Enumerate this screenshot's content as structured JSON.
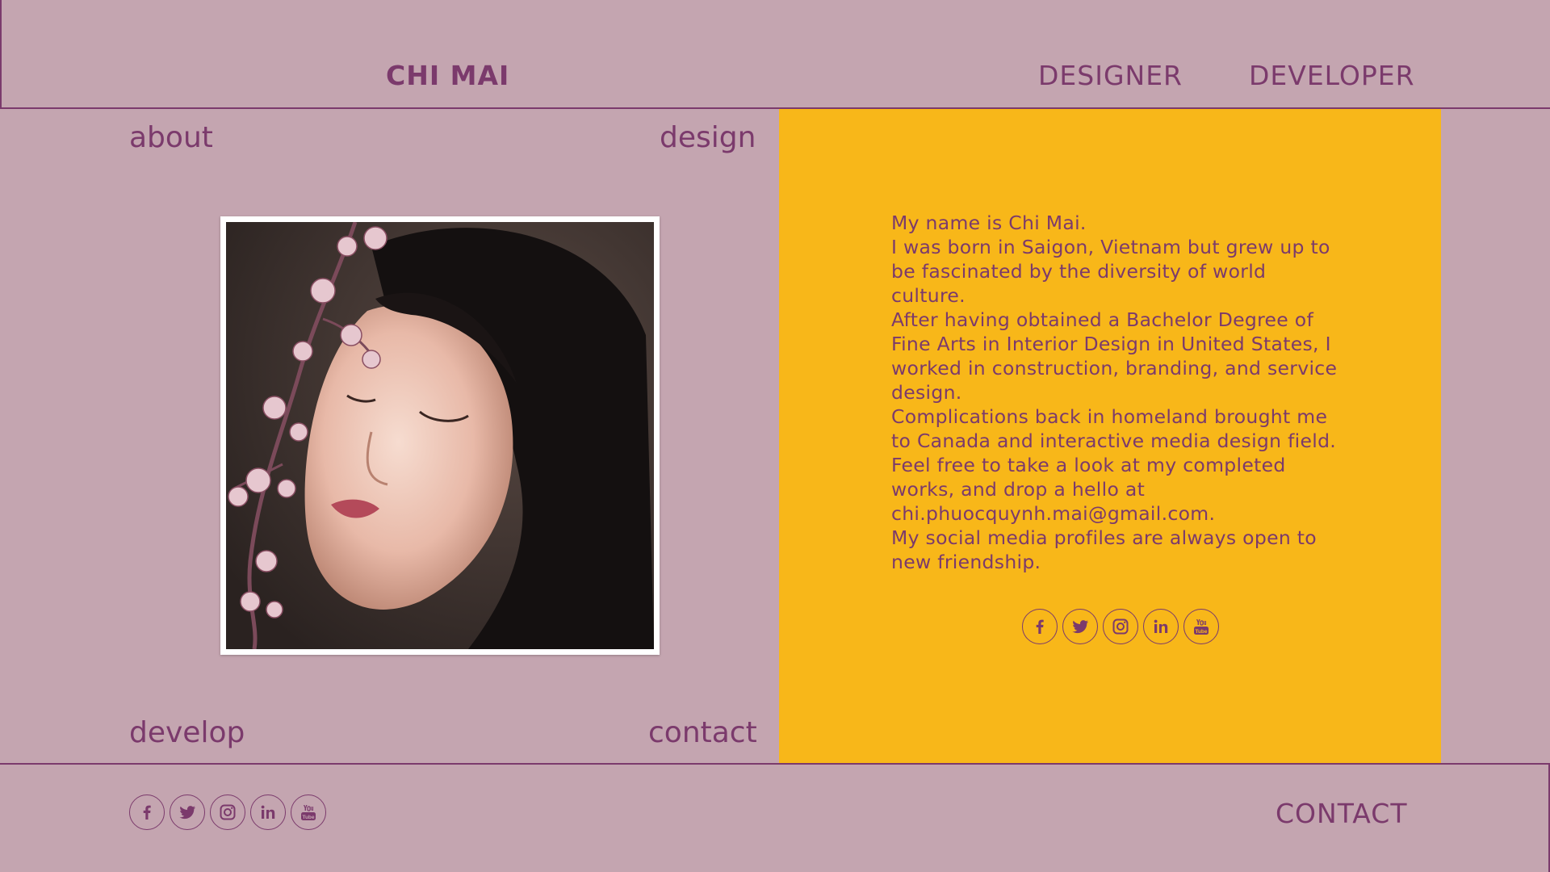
{
  "header": {
    "brand": "CHI MAI",
    "nav": [
      {
        "label": "DESIGNER"
      },
      {
        "label": "DEVELOPER"
      }
    ]
  },
  "corners": {
    "about": "about",
    "design": "design",
    "develop": "develop",
    "contact": "contact"
  },
  "bio": {
    "lines": [
      "My name is Chi Mai.",
      "I was born in Saigon, Vietnam but grew up to be fascinated by the diversity of world culture.",
      "After having obtained a Bachelor Degree of Fine Arts in Interior Design in United States, I worked in construction, branding, and service design.",
      "Complications back in homeland brought me to Canada and interactive media design field.",
      "Feel free to take a look at my completed works, and drop a hello at chi.phuocquynh.mai@gmail.com.",
      "My social media profiles are always open to new friendship."
    ]
  },
  "social": {
    "icons": [
      "facebook-icon",
      "twitter-icon",
      "instagram-icon",
      "linkedin-icon",
      "youtube-icon"
    ]
  },
  "footer": {
    "contact_label": "CONTACT"
  },
  "colors": {
    "background": "#c4a5b0",
    "accent": "#7b3a6c",
    "panel": "#f8b719"
  }
}
